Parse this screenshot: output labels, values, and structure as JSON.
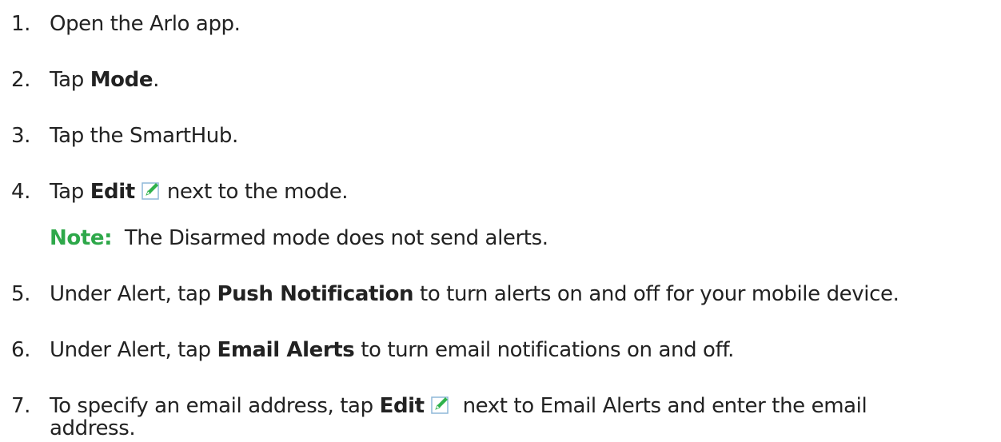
{
  "steps": [
    {
      "num": "1.",
      "text": "Open the Arlo app."
    },
    {
      "num": "2.",
      "pre": "Tap ",
      "bold": "Mode",
      "post": "."
    },
    {
      "num": "3.",
      "text": "Tap the SmartHub."
    },
    {
      "num": "4.",
      "pre": "Tap ",
      "bold": "Edit",
      "post": "next to the mode.",
      "icon": "edit-pencil-icon"
    },
    {
      "num": "5.",
      "pre": "Under Alert, tap ",
      "bold": "Push Notification",
      "post": " to turn alerts on and off for your mobile device."
    },
    {
      "num": "6.",
      "pre": "Under Alert, tap ",
      "bold": "Email Alerts",
      "post": " to turn email notifications on and off."
    },
    {
      "num": "7.",
      "pre": "To specify an email address, tap ",
      "bold": "Edit",
      "post": " next to Email Alerts and enter the email",
      "continuation": "address.",
      "icon": "edit-pencil-icon"
    }
  ],
  "note": {
    "label": "Note:",
    "text": "The Disarmed mode does not send alerts."
  },
  "colors": {
    "note_label": "#2ea84a",
    "icon_green": "#2fb24c",
    "icon_border": "#8fb8d8"
  }
}
